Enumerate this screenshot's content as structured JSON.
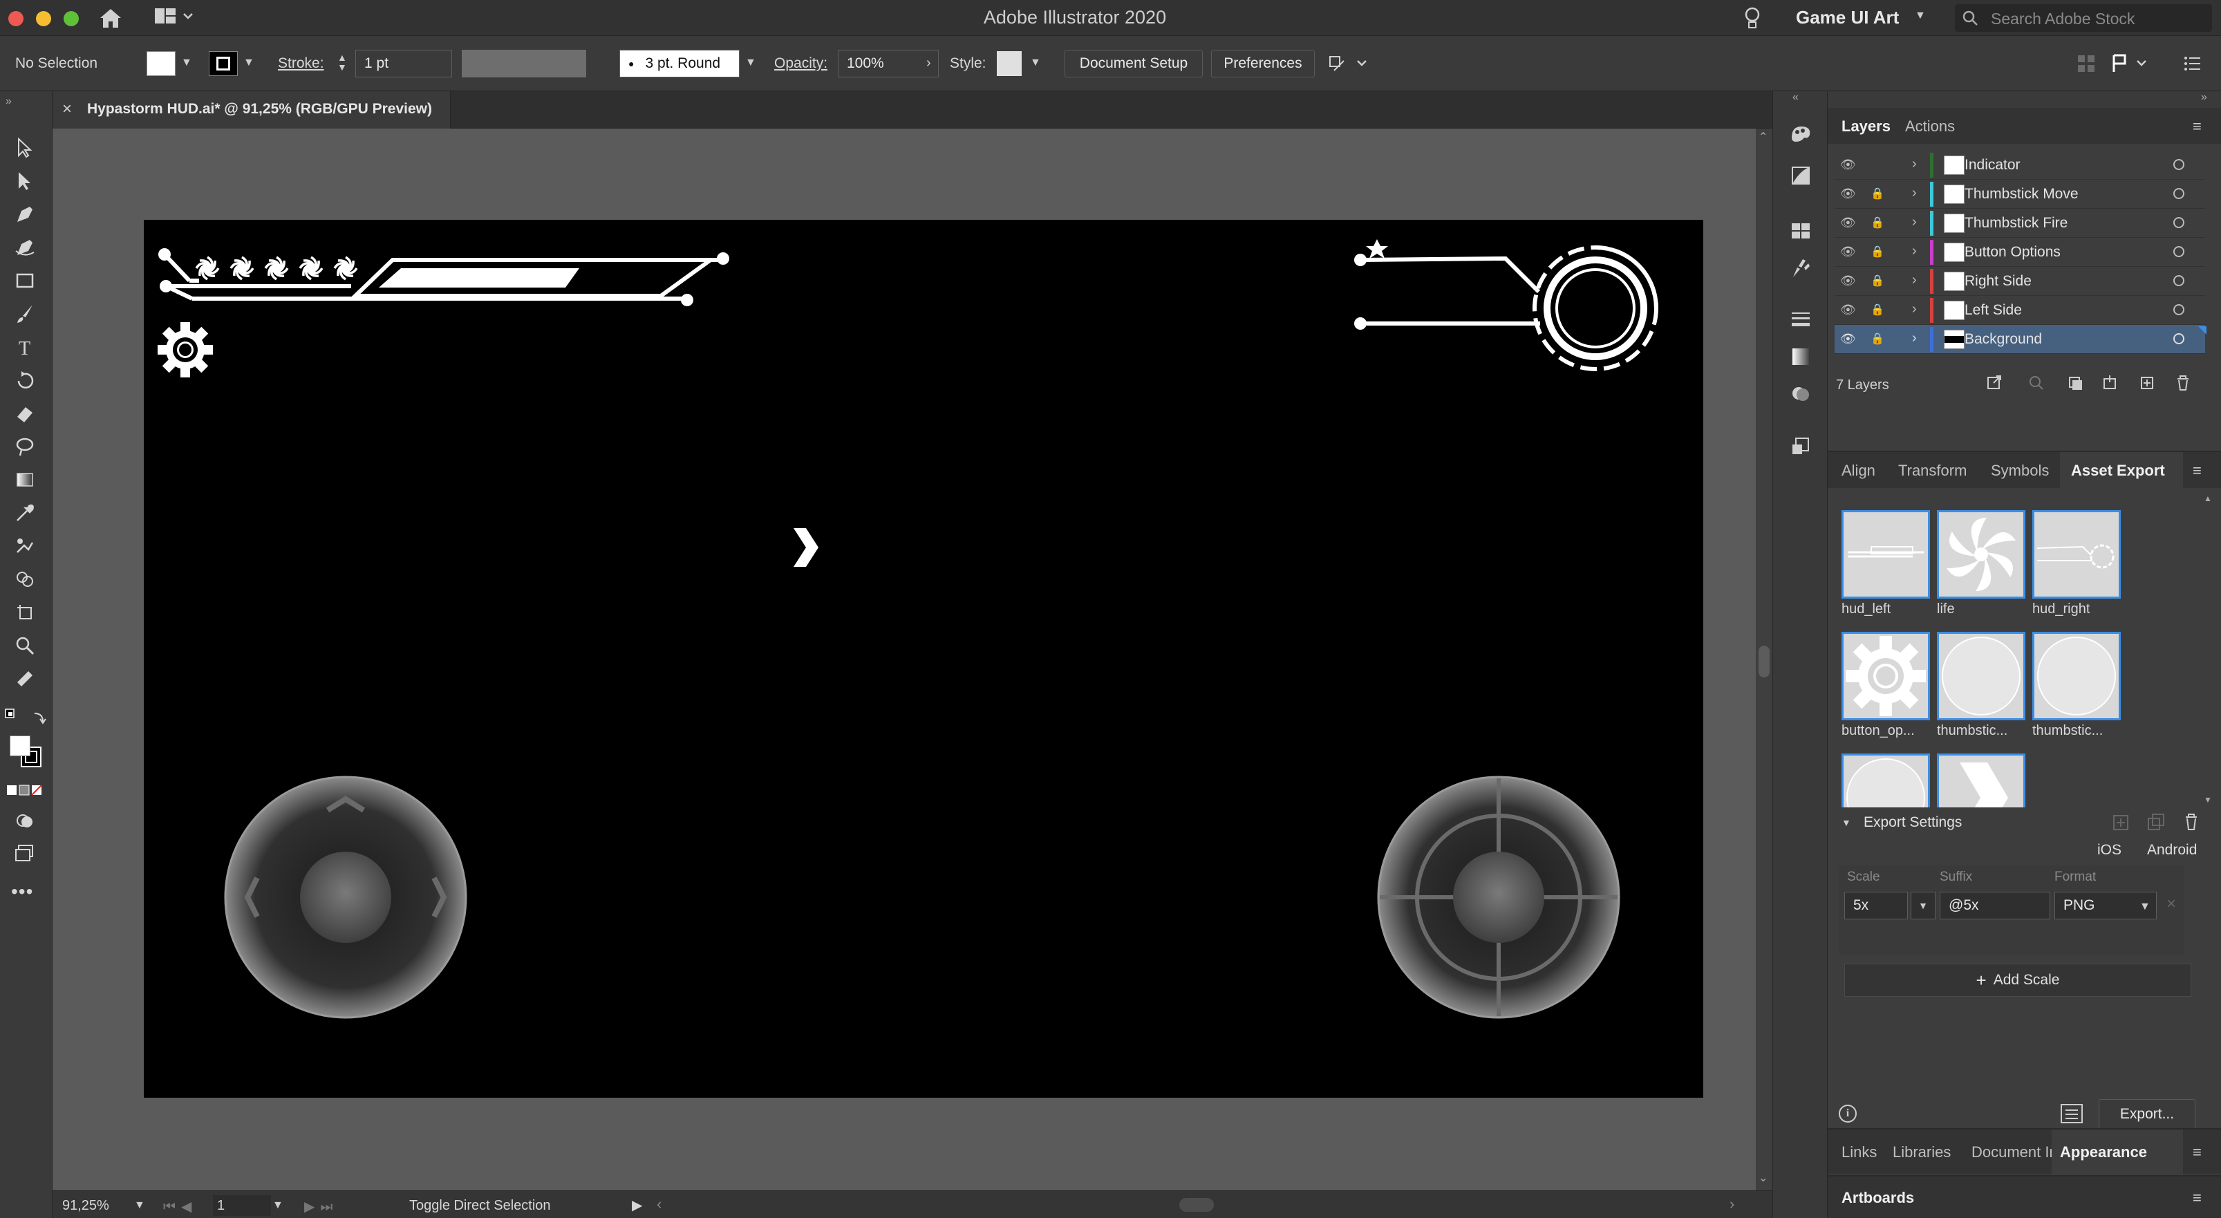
{
  "app": {
    "title": "Adobe Illustrator 2020",
    "workspace": "Game UI Art",
    "search_placeholder": "Search Adobe Stock"
  },
  "controlbar": {
    "selection": "No Selection",
    "stroke_label": "Stroke:",
    "stroke_value": "1 pt",
    "brush_value": "3 pt. Round",
    "opacity_label": "Opacity:",
    "opacity_value": "100%",
    "style_label": "Style:",
    "document_setup": "Document Setup",
    "preferences": "Preferences"
  },
  "document": {
    "tab_title": "Hypastorm HUD.ai* @ 91,25% (RGB/GPU Preview)"
  },
  "layers_panel": {
    "tabs": [
      "Layers",
      "Actions"
    ],
    "layers": [
      {
        "name": "Indicator",
        "color": "#2f6f2f"
      },
      {
        "name": "Thumbstick Move",
        "color": "#3fc8d8"
      },
      {
        "name": "Thumbstick Fire",
        "color": "#3fc8d8"
      },
      {
        "name": "Button Options",
        "color": "#c83fc8"
      },
      {
        "name": "Right Side",
        "color": "#d84040"
      },
      {
        "name": "Left Side",
        "color": "#d84040"
      },
      {
        "name": "Background",
        "color": "#3f6fd8"
      }
    ],
    "count": "7 Layers"
  },
  "asset_panel": {
    "tabs": [
      "Align",
      "Transform",
      "Symbols",
      "Asset Export"
    ],
    "assets": [
      "hud_left",
      "life",
      "hud_right",
      "button_op...",
      "thumbstic...",
      "thumbstic..."
    ],
    "export_settings": "Export Settings",
    "ios": "iOS",
    "android": "Android",
    "scale_label": "Scale",
    "suffix_label": "Suffix",
    "format_label": "Format",
    "scale_value": "5x",
    "suffix_value": "@5x",
    "format_value": "PNG",
    "add_scale": "Add Scale",
    "export_button": "Export..."
  },
  "bottom_panels": {
    "tabs": [
      "Links",
      "Libraries",
      "Document In",
      "Appearance"
    ],
    "artboards": "Artboards"
  },
  "status": {
    "zoom": "91,25%",
    "artboard_number": "1",
    "tool_hint": "Toggle Direct Selection"
  }
}
